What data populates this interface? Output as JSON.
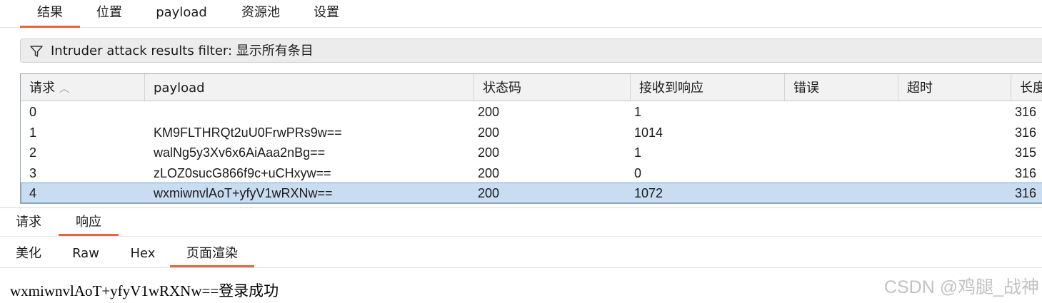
{
  "top_tabs": [
    "结果",
    "位置",
    "payload",
    "资源池",
    "设置"
  ],
  "filter": {
    "text": "Intruder attack results filter: 显示所有条目"
  },
  "table": {
    "columns": [
      "请求",
      "payload",
      "状态码",
      "接收到响应",
      "错误",
      "超时",
      "长度"
    ],
    "rows": [
      [
        "0",
        "",
        "200",
        "1",
        "",
        "",
        "316"
      ],
      [
        "1",
        "KM9FLTHRQt2uU0FrwPRs9w==",
        "200",
        "1014",
        "",
        "",
        "316"
      ],
      [
        "2",
        "walNg5y3Xv6x6AiAaa2nBg==",
        "200",
        "1",
        "",
        "",
        "315"
      ],
      [
        "3",
        "zLOZ0sucG866f9c+uCHxyw==",
        "200",
        "0",
        "",
        "",
        "316"
      ],
      [
        "4",
        "wxmiwnvlAoT+yfyV1wRXNw==",
        "200",
        "1072",
        "",
        "",
        "316"
      ]
    ],
    "selected_row": 4,
    "sort_indicator": "^"
  },
  "detail_tabs": [
    "请求",
    "响应"
  ],
  "view_tabs": [
    "美化",
    "Raw",
    "Hex",
    "页面渲染"
  ],
  "rendered_text": "wxmiwnvlAoT+yfyV1wRXNw==登录成功",
  "watermark": "CSDN @鸡腿_战神",
  "colors": {
    "accent": "#e8643c",
    "selection": "#c8dcf2"
  }
}
